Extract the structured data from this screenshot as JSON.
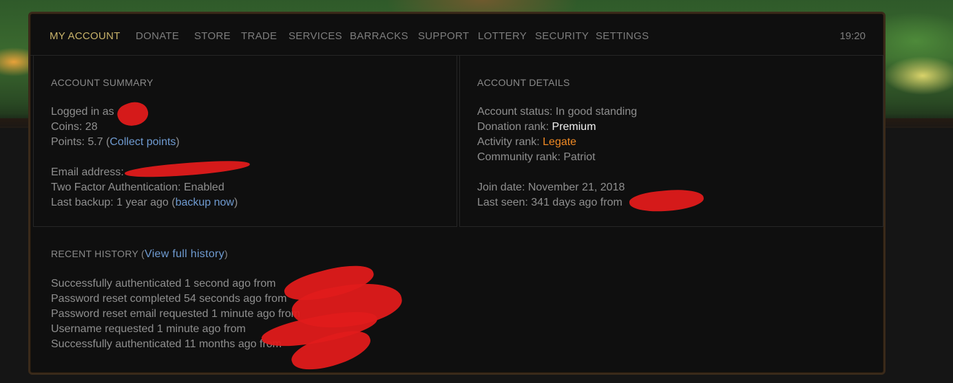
{
  "nav": {
    "items": [
      "MY ACCOUNT",
      "DONATE",
      "STORE",
      "TRADE",
      "SERVICES",
      "BARRACKS",
      "SUPPORT",
      "LOTTERY",
      "SECURITY",
      "SETTINGS"
    ],
    "active": "MY ACCOUNT",
    "clock": "19:20"
  },
  "summary": {
    "title": "ACCOUNT SUMMARY",
    "logged_in_label": "Logged in as",
    "coins": "Coins: 28",
    "points_prefix": "Points: 5.7 (",
    "points_link": "Collect points",
    "points_suffix": ")",
    "email_label": "Email address:",
    "two_factor": "Two Factor Authentication: Enabled",
    "backup_prefix": "Last backup: 1 year ago (",
    "backup_link": "backup now",
    "backup_suffix": ")"
  },
  "details": {
    "title": "ACCOUNT DETAILS",
    "status": "Account status: In good standing",
    "donation_label": "Donation rank: ",
    "donation_value": "Premium",
    "activity_label": "Activity rank: ",
    "activity_value": "Legate",
    "community": "Community rank: Patriot",
    "join_date": "Join date: November 21, 2018",
    "last_seen": "Last seen: 341 days ago from"
  },
  "history": {
    "title": "RECENT HISTORY (",
    "link": "View full history",
    "title_suffix": ")",
    "entries": [
      "Successfully authenticated 1 second ago from",
      "Password reset completed 54 seconds ago from",
      "Password reset email requested 1 minute ago from",
      "Username requested 1 minute ago from",
      "Successfully authenticated 11 months ago from"
    ]
  },
  "colors": {
    "accent_gold": "#c9b36a",
    "link_blue": "#6f9bd1",
    "legate_orange": "#f08a24",
    "redaction_red": "#e01b1b"
  }
}
